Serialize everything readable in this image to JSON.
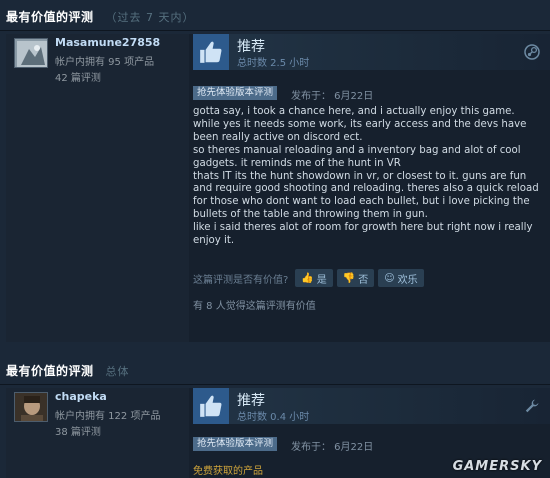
{
  "sections": [
    {
      "title": "最有价值的评测",
      "subtitle": "（过去 7 天内）"
    },
    {
      "title": "最有价值的评测",
      "subtitle": "总体"
    }
  ],
  "reviews": [
    {
      "username": "Masamune27858",
      "products_owned": "帐户内拥有 95 项产品",
      "reviews_count": "42 篇评测",
      "verdict": "推荐",
      "hours": "总时数 2.5 小时",
      "early_access_badge": "抢先体验版本评测",
      "posted": "发布于：   6月22日",
      "text": "gotta say, i took a chance here, and i actually enjoy this game.\nwhile yes it needs some work, its early access and the devs have been really active on discord ect.\nso theres manual reloading and a inventory bag and alot of cool gadgets. it reminds me of the hunt in VR\nthats IT its the hunt showdown in vr, or closest to it. guns are fun and require good shooting and reloading. theres also a quick reload for those who dont want to load each bullet, but i love picking the bullets of the table and throwing them in gun.\nlike i said theres alot of room for growth here but right now i really enjoy it.",
      "helpful_question": "这篇评测是否有价值?",
      "vote_yes": "是",
      "vote_no": "否",
      "vote_funny": "欢乐",
      "found_helpful": "有 8 人觉得这篇评测有价值",
      "corner_icon": "steam-icon"
    },
    {
      "username": "chapeka",
      "products_owned": "帐户内拥有 122 项产品",
      "reviews_count": "38 篇评测",
      "verdict": "推荐",
      "hours": "总时数 0.4 小时",
      "early_access_badge": "抢先体验版本评测",
      "posted": "发布于：   6月22日",
      "free_product": "免费获取的产品",
      "corner_icon": "wrench-icon"
    }
  ],
  "watermark": "GAMERSKY",
  "colors": {
    "background": "#1b2838",
    "badge": "#4c6b8a",
    "thumb_box": "#2d5a8c",
    "free_product": "#d1a63c"
  }
}
